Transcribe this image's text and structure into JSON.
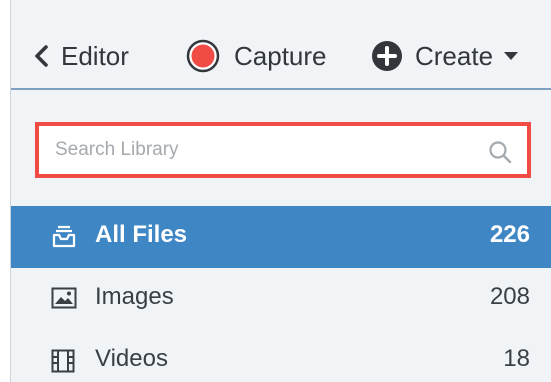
{
  "toolbar": {
    "editor_label": "Editor",
    "capture_label": "Capture",
    "create_label": "Create",
    "capture_color": "#f04b44"
  },
  "search": {
    "placeholder": "Search Library",
    "highlight_color": "#f04b44"
  },
  "library": {
    "items": [
      {
        "label": "All Files",
        "count": "226",
        "icon": "inbox-tray-icon",
        "active": true
      },
      {
        "label": "Images",
        "count": "208",
        "icon": "image-icon",
        "active": false
      },
      {
        "label": "Videos",
        "count": "18",
        "icon": "film-icon",
        "active": false
      }
    ],
    "active_color": "#3f87c4"
  }
}
